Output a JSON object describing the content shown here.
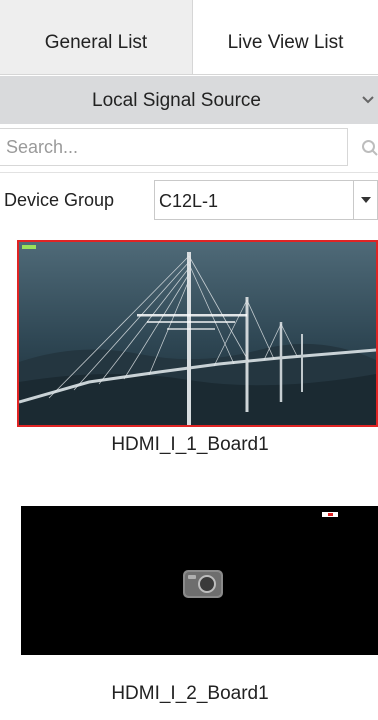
{
  "tabs": [
    {
      "label": "General List",
      "active": false
    },
    {
      "label": "Live View List",
      "active": true
    }
  ],
  "signal_source": {
    "label": "Local Signal Source",
    "icon": "chevron-down-icon"
  },
  "search": {
    "value": "",
    "placeholder": "Search...",
    "icon": "search-icon"
  },
  "device_group": {
    "label": "Device Group",
    "value": "C12L-1",
    "icon": "caret-down-icon"
  },
  "sources": [
    {
      "name": "HDMI_I_1_Board1",
      "selected": true
    },
    {
      "name": "HDMI_I_2_Board1",
      "selected": false
    }
  ],
  "colors": {
    "selection_border": "#e02424",
    "header_bg": "#eeeeee",
    "source_bar_bg": "#d9dadc"
  }
}
